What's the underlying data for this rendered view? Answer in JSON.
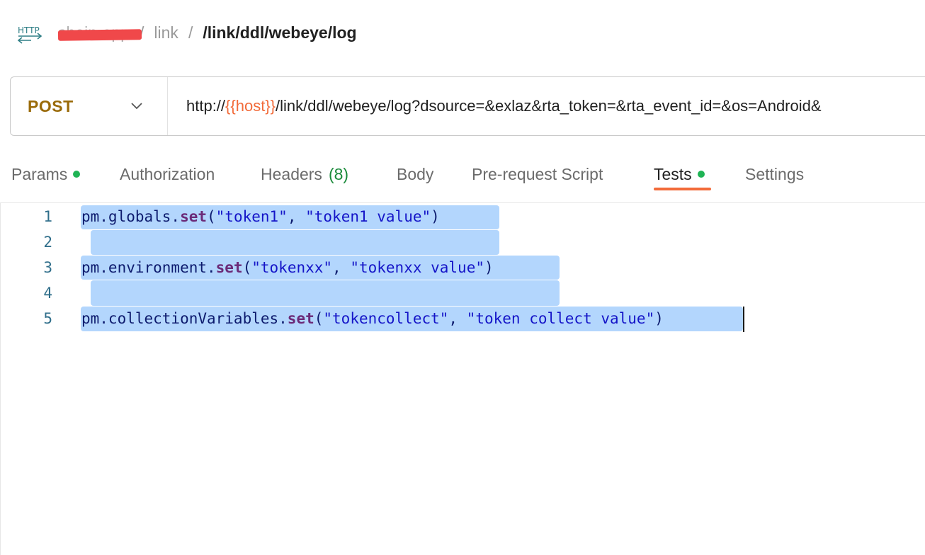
{
  "breadcrumb": {
    "icon": "http-request-icon",
    "collection": "shein-app",
    "folder": "link",
    "request": "/link/ddl/webeye/log",
    "separator": "/"
  },
  "request": {
    "method": "POST",
    "url_prefix": "http://",
    "url_variable": "{{host}}",
    "url_rest": "/link/ddl/webeye/log?dsource=&exlaz&rta_token=&rta_event_id=&os=Android&"
  },
  "tabs": [
    {
      "label": "Params",
      "dot": true
    },
    {
      "label": "Authorization"
    },
    {
      "label": "Headers",
      "count": "(8)"
    },
    {
      "label": "Body"
    },
    {
      "label": "Pre-request Script"
    },
    {
      "label": "Tests",
      "dot": true,
      "active": true
    },
    {
      "label": "Settings"
    }
  ],
  "editor": {
    "lines": [
      {
        "n": "1",
        "obj": "pm.globals.",
        "fn": "set",
        "open": "(",
        "a1": "\"token1\"",
        "sep": ", ",
        "a2": "\"token1 value\"",
        "close": ")"
      },
      {
        "n": "2"
      },
      {
        "n": "3",
        "obj": "pm.environment.",
        "fn": "set",
        "open": "(",
        "a1": "\"tokenxx\"",
        "sep": ", ",
        "a2": "\"tokenxx value\"",
        "close": ")"
      },
      {
        "n": "4"
      },
      {
        "n": "5",
        "obj": "pm.collectionVariables.",
        "fn": "set",
        "open": "(",
        "a1": "\"tokencollect\"",
        "sep": ", ",
        "a2": "\"token collect value\"",
        "close": ")"
      }
    ]
  },
  "colors": {
    "method": "#9a6b0a",
    "variable": "#f26b3a",
    "active_tab_underline": "#f26b3a",
    "status_dot": "#1fb455",
    "selection": "#b3d6fd"
  }
}
